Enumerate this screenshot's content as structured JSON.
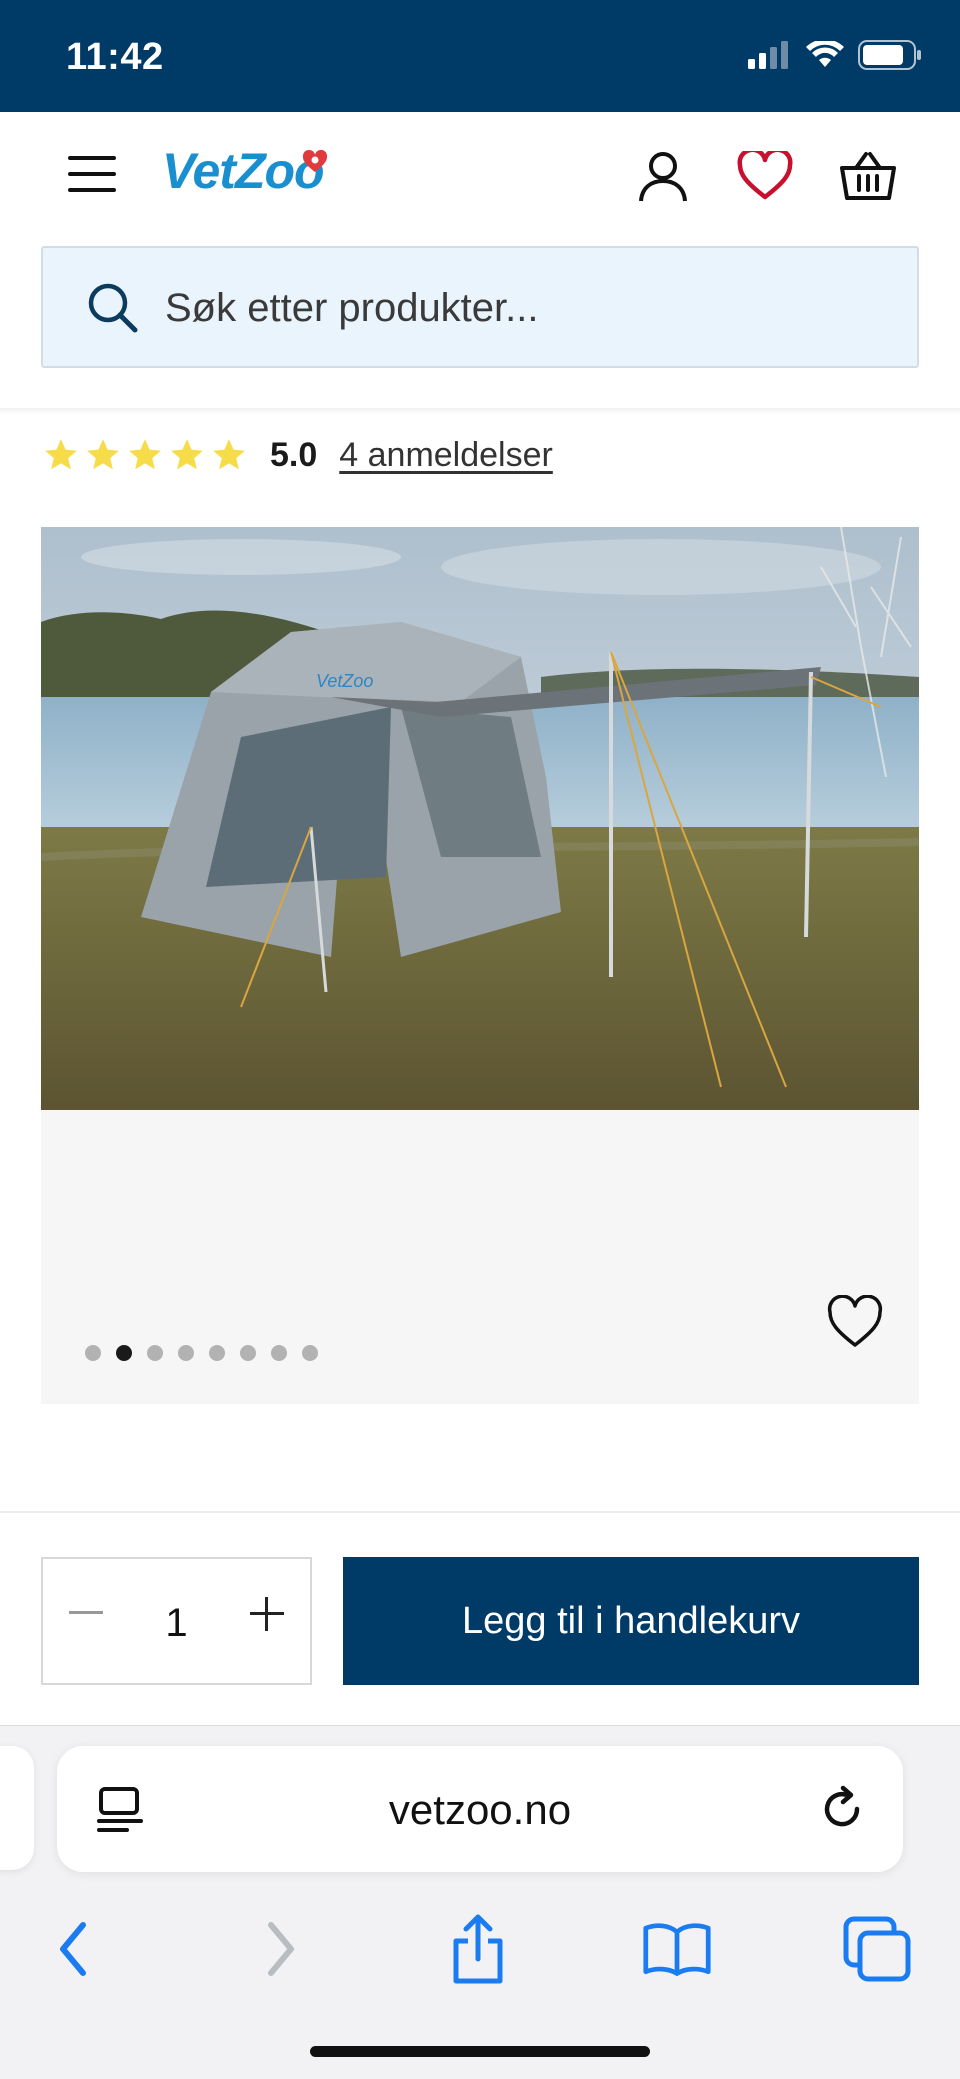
{
  "status_bar": {
    "time": "11:42"
  },
  "header": {
    "logo": "VetZoo"
  },
  "search": {
    "placeholder": "Søk etter produkter..."
  },
  "rating": {
    "stars": 5,
    "value": "5.0",
    "reviews_link": "4 anmeldelser"
  },
  "gallery": {
    "image_count": 8,
    "active_index": 1
  },
  "purchase": {
    "quantity": "1",
    "add_to_cart_label": "Legg til i handlekurv"
  },
  "browser": {
    "url": "vetzoo.no"
  },
  "colors": {
    "brand_navy": "#003a66",
    "logo_blue": "#1a8fd0",
    "heart_red": "#c8102e",
    "star_yellow": "#f7dc4a",
    "ios_blue": "#1a7cf0"
  }
}
